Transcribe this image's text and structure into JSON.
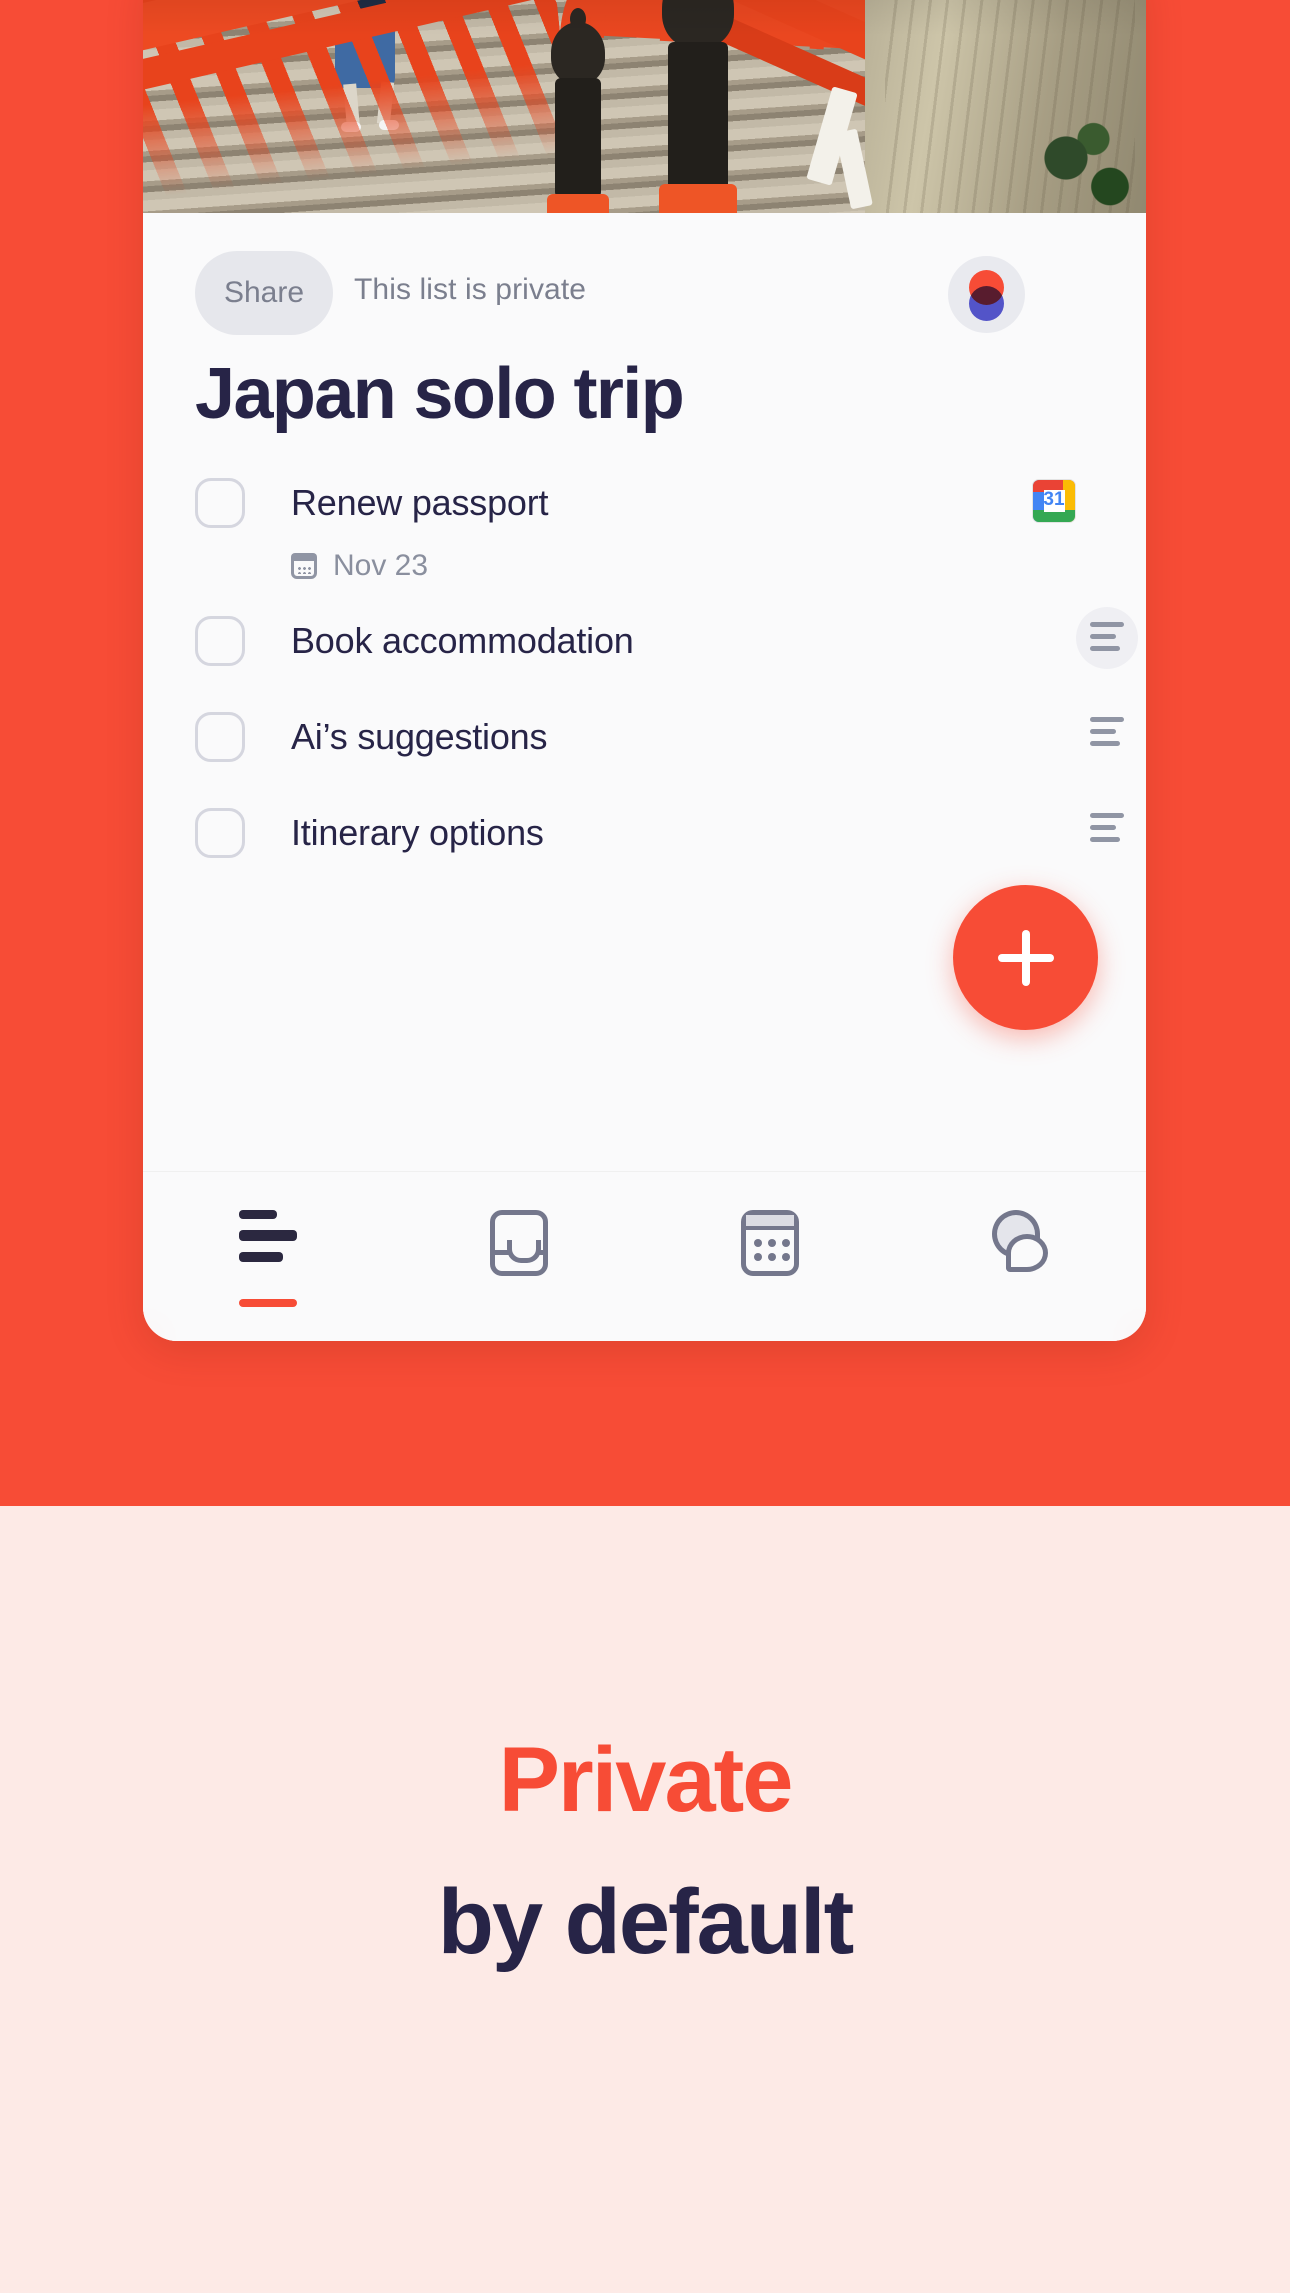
{
  "theme": {
    "accent": "#F74C36",
    "dark_text": "#272447",
    "muted_text": "#7B7F8E",
    "card_bg": "#FAFAFB",
    "promo_bg": "#FDEAE6"
  },
  "hero": {
    "photo_alt": "Vermilion Japanese shrine bridge with stone staircase and ornamental posts"
  },
  "app": {
    "share": {
      "button_label": "Share",
      "privacy_label": "This list is private",
      "avatar_name": "user-avatar"
    },
    "title": "Japan solo trip",
    "tasks": [
      {
        "label": "Renew passport",
        "due": "Nov 23",
        "due_icon": "calendar-icon",
        "integration_icon": "google-calendar-icon",
        "integration_day": "31",
        "checked": false,
        "handle": "drag-handle"
      },
      {
        "label": "Book accommodation",
        "due": "",
        "checked": false,
        "handle": "drag-handle"
      },
      {
        "label": "Ai’s suggestions",
        "due": "",
        "checked": false,
        "handle": "drag-handle"
      },
      {
        "label": "Itinerary options",
        "due": "",
        "checked": false,
        "handle": "drag-handle"
      }
    ],
    "fab": {
      "label": "+",
      "name": "add-task-button"
    },
    "nav": [
      {
        "name": "nav-lists",
        "icon": "list-icon",
        "active": true
      },
      {
        "name": "nav-inbox",
        "icon": "inbox-icon",
        "active": false
      },
      {
        "name": "nav-calendar",
        "icon": "calendar-icon",
        "active": false
      },
      {
        "name": "nav-chat",
        "icon": "chat-icon",
        "active": false
      }
    ]
  },
  "promo": {
    "line1": "Private",
    "line2": "by default"
  }
}
